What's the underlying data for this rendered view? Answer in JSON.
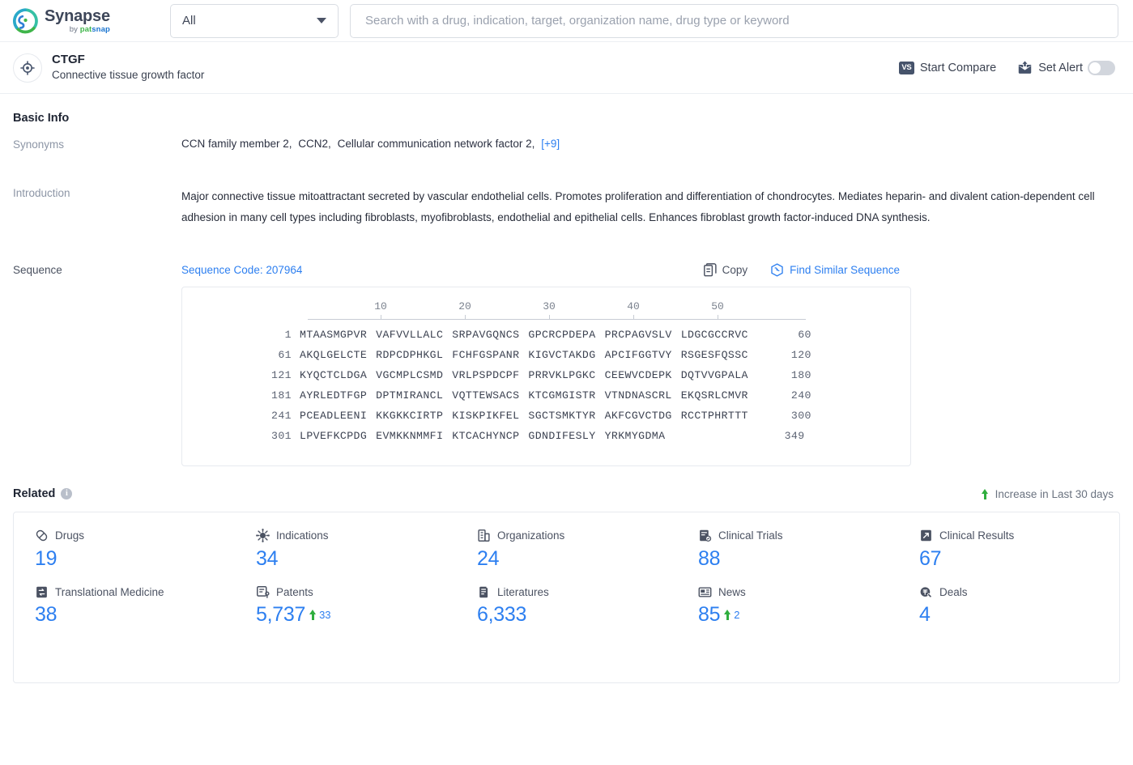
{
  "brand": {
    "name": "Synapse",
    "by": "by ",
    "pat": "pat",
    "snap": "snap",
    "logo_icon": "synapse-logo-icon"
  },
  "search": {
    "category_value": "All",
    "category_icon": "chevron-down-icon",
    "placeholder": "Search with a drug, indication, target, organization name, drug type or keyword",
    "value": ""
  },
  "entity": {
    "icon": "target-icon",
    "title": "CTGF",
    "subtitle": "Connective tissue growth factor",
    "actions": {
      "compare_icon": "vs-icon",
      "compare_label": "Start Compare",
      "alert_icon": "mail-alert-icon",
      "alert_label": "Set Alert",
      "alert_enabled": false
    }
  },
  "basic_info": {
    "heading": "Basic Info",
    "synonyms": {
      "label": "Synonyms",
      "items": [
        "CCN family member 2,",
        "CCN2,",
        "Cellular communication network factor 2,"
      ],
      "more_link": "[+9]"
    },
    "introduction": {
      "label": "Introduction",
      "text": "Major connective tissue mitoattractant secreted by vascular endothelial cells. Promotes proliferation and differentiation of chondrocytes. Mediates heparin- and divalent cation-dependent cell adhesion in many cell types including fibroblasts, myofibroblasts, endothelial and epithelial cells. Enhances fibroblast growth factor-induced DNA synthesis."
    },
    "sequence": {
      "label": "Sequence",
      "code_label": "Sequence Code: 207964",
      "copy_icon": "copy-icon",
      "copy_label": "Copy",
      "similar_icon": "find-similar-icon",
      "similar_label": "Find Similar Sequence",
      "ruler_ticks": [
        "10",
        "20",
        "30",
        "40",
        "50"
      ],
      "rows": [
        {
          "start": "1",
          "chunks": [
            "MTAASMGPVR",
            "VAFVVLLALC",
            "SRPAVGQNCS",
            "GPCRCPDEPA",
            "PRCPAGVSLV",
            "LDGCGCCRVC"
          ],
          "end": "60"
        },
        {
          "start": "61",
          "chunks": [
            "AKQLGELCTE",
            "RDPCDPHKGL",
            "FCHFGSPANR",
            "KIGVCTAKDG",
            "APCIFGGTVY",
            "RSGESFQSSC"
          ],
          "end": "120"
        },
        {
          "start": "121",
          "chunks": [
            "KYQCTCLDGA",
            "VGCMPLCSMD",
            "VRLPSPDCPF",
            "PRRVKLPGKC",
            "CEEWVCDEPK",
            "DQTVVGPALA"
          ],
          "end": "180"
        },
        {
          "start": "181",
          "chunks": [
            "AYRLEDTFGP",
            "DPTMIRANCL",
            "VQTTEWSACS",
            "KTCGMGISTR",
            "VTNDNASCRL",
            "EKQSRLCMVR"
          ],
          "end": "240"
        },
        {
          "start": "241",
          "chunks": [
            "PCEADLEENI",
            "KKGKKCIRTP",
            "KISKPIKFEL",
            "SGCTSMKTYR",
            "AKFCGVCTDG",
            "RCCTPHRTTT"
          ],
          "end": "300"
        },
        {
          "start": "301",
          "chunks": [
            "LPVEFKCPDG",
            "EVMKKNMMFI",
            "KTCACHYNCP",
            "GDNDIFESLY",
            "YRKMYGDMA"
          ],
          "end": "349"
        }
      ]
    }
  },
  "related": {
    "heading": "Related",
    "info_icon": "info-icon",
    "info_glyph": "i",
    "legend_icon": "arrow-up-icon",
    "legend_label": "Increase in Last 30 days",
    "stats": [
      {
        "icon": "pill-icon",
        "label": "Drugs",
        "value": "19",
        "delta": ""
      },
      {
        "icon": "virus-icon",
        "label": "Indications",
        "value": "34",
        "delta": ""
      },
      {
        "icon": "building-icon",
        "label": "Organizations",
        "value": "24",
        "delta": ""
      },
      {
        "icon": "clinical-trial-icon",
        "label": "Clinical Trials",
        "value": "88",
        "delta": ""
      },
      {
        "icon": "clinical-result-icon",
        "label": "Clinical Results",
        "value": "67",
        "delta": ""
      },
      {
        "icon": "translational-icon",
        "label": "Translational Medicine",
        "value": "38",
        "delta": ""
      },
      {
        "icon": "patent-icon",
        "label": "Patents",
        "value": "5,737",
        "delta": "33"
      },
      {
        "icon": "literature-icon",
        "label": "Literatures",
        "value": "6,333",
        "delta": ""
      },
      {
        "icon": "news-icon",
        "label": "News",
        "value": "85",
        "delta": "2"
      },
      {
        "icon": "deal-icon",
        "label": "Deals",
        "value": "4",
        "delta": ""
      }
    ]
  },
  "colors": {
    "accent_blue": "#2d7ff0",
    "green": "#2fae3e",
    "navy": "#46536b"
  }
}
